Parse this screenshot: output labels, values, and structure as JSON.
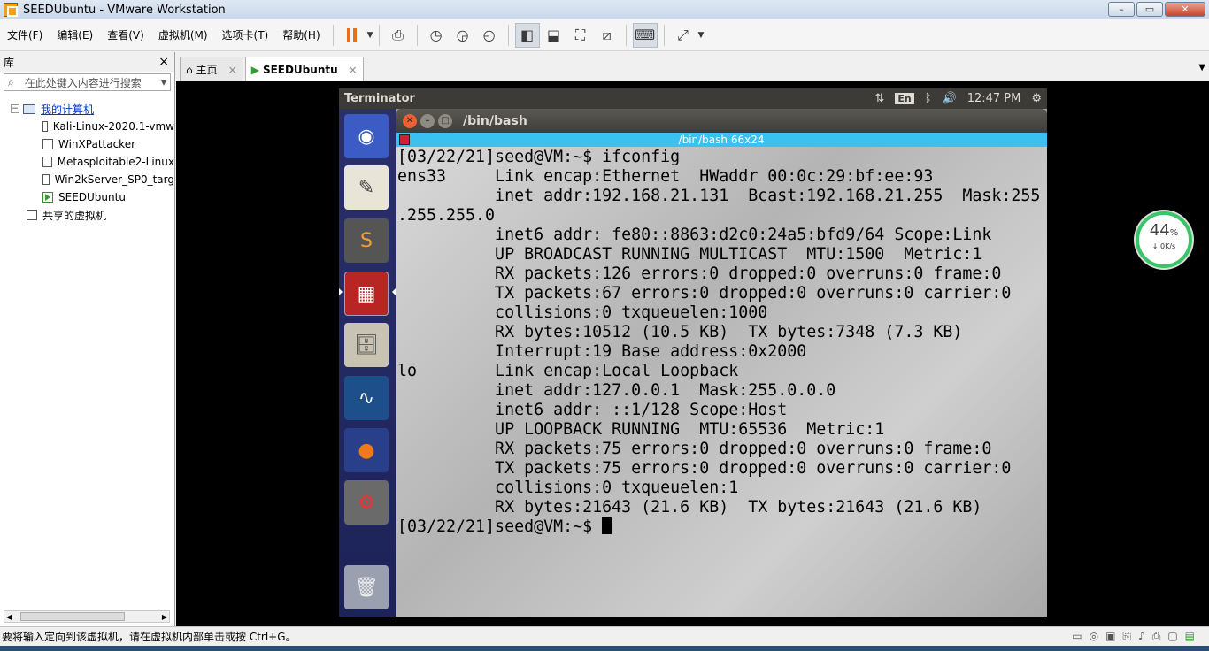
{
  "window": {
    "title": "SEEDUbuntu - VMware Workstation",
    "controls": [
      "–",
      "▭",
      "✕"
    ]
  },
  "menu": [
    "文件(F)",
    "编辑(E)",
    "查看(V)",
    "虚拟机(M)",
    "选项卡(T)",
    "帮助(H)"
  ],
  "library": {
    "title": "库",
    "close": "×",
    "search_placeholder": "在此处键入内容进行搜索",
    "root_label": "我的计算机",
    "vms": [
      "Kali-Linux-2020.1-vmw",
      "WinXPattacker",
      "Metasploitable2-Linux",
      "Win2kServer_SP0_targ",
      "SEEDUbuntu"
    ],
    "shared": "共享的虚拟机"
  },
  "tabs": [
    {
      "label": "主页",
      "close": "×"
    },
    {
      "label": "SEEDUbuntu",
      "close": "×"
    }
  ],
  "guest": {
    "topbar": {
      "app": "Terminator",
      "lang": "En",
      "time": "12:47 PM"
    },
    "terminal": {
      "title": "/bin/bash",
      "tab": "/bin/bash 66x24",
      "lines": [
        "[03/22/21]seed@VM:~$ ifconfig",
        "ens33     Link encap:Ethernet  HWaddr 00:0c:29:bf:ee:93",
        "          inet addr:192.168.21.131  Bcast:192.168.21.255  Mask:255",
        ".255.255.0",
        "          inet6 addr: fe80::8863:d2c0:24a5:bfd9/64 Scope:Link",
        "          UP BROADCAST RUNNING MULTICAST  MTU:1500  Metric:1",
        "          RX packets:126 errors:0 dropped:0 overruns:0 frame:0",
        "          TX packets:67 errors:0 dropped:0 overruns:0 carrier:0",
        "          collisions:0 txqueuelen:1000",
        "          RX bytes:10512 (10.5 KB)  TX bytes:7348 (7.3 KB)",
        "          Interrupt:19 Base address:0x2000",
        "",
        "lo        Link encap:Local Loopback",
        "          inet addr:127.0.0.1  Mask:255.0.0.0",
        "          inet6 addr: ::1/128 Scope:Host",
        "          UP LOOPBACK RUNNING  MTU:65536  Metric:1",
        "          RX packets:75 errors:0 dropped:0 overruns:0 frame:0",
        "          TX packets:75 errors:0 dropped:0 overruns:0 carrier:0",
        "          collisions:0 txqueuelen:1",
        "          RX bytes:21643 (21.6 KB)  TX bytes:21643 (21.6 KB)",
        ""
      ],
      "prompt": "[03/22/21]seed@VM:~$ "
    },
    "ime": {
      "logo": "S",
      "mode": "英"
    }
  },
  "speed_widget": {
    "percent": "44",
    "unit": "%",
    "rate": "↓ 0K/s"
  },
  "status": {
    "text": "要将输入定向到该虚拟机，请在虚拟机内部单击或按 Ctrl+G。"
  },
  "colors": {
    "accent_green": "#3ac468",
    "term_tab": "#3ac1f0",
    "launcher": "#2b2f6b"
  }
}
